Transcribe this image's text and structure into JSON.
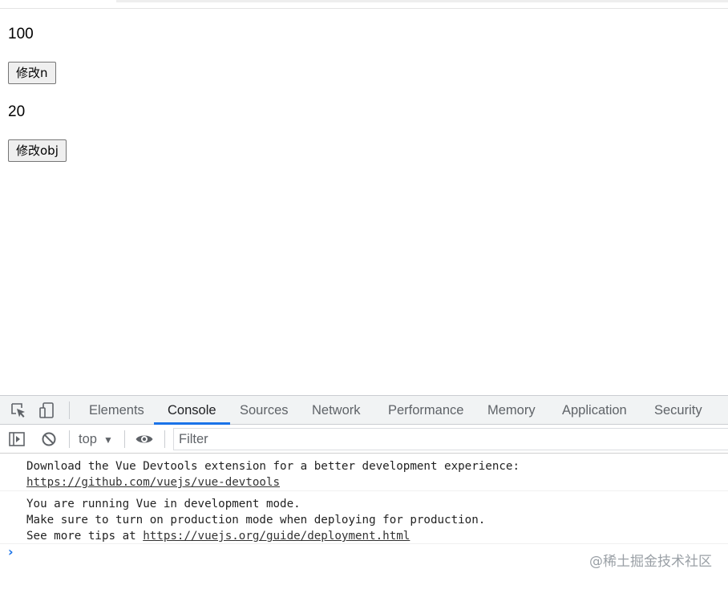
{
  "page": {
    "n_value": "100",
    "modify_n_label": "修改n",
    "obj_value": "20",
    "modify_obj_label": "修改obj"
  },
  "devtools": {
    "tabs": [
      {
        "label": "Elements",
        "active": false
      },
      {
        "label": "Console",
        "active": true
      },
      {
        "label": "Sources",
        "active": false
      },
      {
        "label": "Network",
        "active": false
      },
      {
        "label": "Performance",
        "active": false
      },
      {
        "label": "Memory",
        "active": false
      },
      {
        "label": "Application",
        "active": false
      },
      {
        "label": "Security",
        "active": false
      }
    ],
    "toolbar": {
      "context": "top",
      "filter_placeholder": "Filter",
      "filter_value": ""
    },
    "console": {
      "msg1_line1": "Download the Vue Devtools extension for a better development experience:",
      "msg1_link": "https://github.com/vuejs/vue-devtools",
      "msg2_line1": "You are running Vue in development mode.",
      "msg2_line2": "Make sure to turn on production mode when deploying for production.",
      "msg2_line3_prefix": "See more tips at ",
      "msg2_link": "https://vuejs.org/guide/deployment.html",
      "prompt_symbol": "›"
    },
    "watermark": "@稀土掘金技术社区"
  },
  "colors": {
    "accent": "#1a73e8",
    "tab_bar_bg": "#f1f3f4",
    "button_bg": "#efefef"
  },
  "icons": [
    "inspect-element-icon",
    "device-toolbar-icon",
    "show-sidebar-icon",
    "clear-console-icon",
    "eye-icon",
    "chevron-down-icon"
  ]
}
